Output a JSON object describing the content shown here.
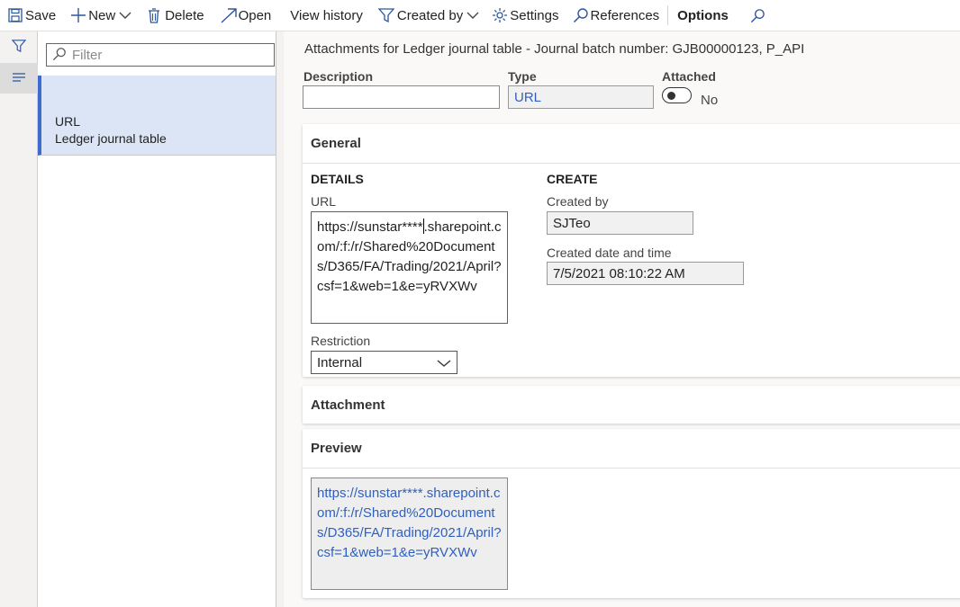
{
  "toolbar": {
    "save": "Save",
    "new": "New",
    "delete": "Delete",
    "open": "Open",
    "view_history": "View history",
    "created_by": "Created by",
    "settings": "Settings",
    "references": "References",
    "options": "Options"
  },
  "list": {
    "filter_placeholder": "Filter",
    "items": [
      {
        "type": "URL",
        "name": "Ledger journal table",
        "selected": true
      }
    ]
  },
  "form": {
    "title": "Attachments for Ledger journal table - Journal batch number: GJB00000123, P_API",
    "description_label": "Description",
    "description_value": "",
    "type_label": "Type",
    "type_value": "URL",
    "attached_label": "Attached",
    "attached_value": "No"
  },
  "general": {
    "header": "General",
    "details_heading": "DETAILS",
    "url_label": "URL",
    "url_before_caret": "https://sunstar****",
    "url_after_caret": ".sharepoint.com/:f:/r/Shared%20Documents/D365/FA/Trading/2021/April?csf=1&web=1&e=yRVXWv",
    "restriction_label": "Restriction",
    "restriction_value": "Internal",
    "create_heading": "CREATE",
    "created_by_label": "Created by",
    "created_by_value": "SJTeo",
    "created_date_label": "Created date and time",
    "created_date_value": "7/5/2021 08:10:22 AM"
  },
  "attachment": {
    "header": "Attachment"
  },
  "preview": {
    "header": "Preview",
    "link": "https://sunstar****.sharepoint.com/:f:/r/Shared%20Documents/D365/FA/Trading/2021/April?csf=1&web=1&e=yRVXWv"
  },
  "colors": {
    "accent": "#3e6bd0",
    "selected_row": "#dce5f5",
    "link": "#2f5fbf"
  }
}
